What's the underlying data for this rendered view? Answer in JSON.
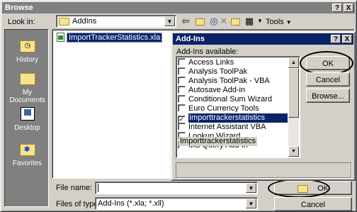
{
  "browse": {
    "title": "Browse",
    "title_buttons": [
      "?",
      "X"
    ],
    "look_in_label": "Look in:",
    "look_in_value": "AddIns",
    "tools_label": "Tools",
    "places": [
      "History",
      "My Documents",
      "Desktop",
      "Favorites"
    ],
    "file": "ImportTrackerStatistics.xla",
    "file_name_label": "File name:",
    "file_name_value": "",
    "files_of_type_label": "Files of type:",
    "files_of_type_value": "Add-Ins (*.xla; *.xll)",
    "ok_label": "OK",
    "cancel_label": "Cancel"
  },
  "addins": {
    "title": "Add-Ins",
    "title_buttons": [
      "?",
      "X"
    ],
    "available_label": "Add-Ins available:",
    "items": [
      {
        "label": "Access Links",
        "checked": false,
        "selected": false
      },
      {
        "label": "Analysis ToolPak",
        "checked": false,
        "selected": false
      },
      {
        "label": "Analysis ToolPak - VBA",
        "checked": false,
        "selected": false
      },
      {
        "label": "Autosave Add-in",
        "checked": false,
        "selected": false
      },
      {
        "label": "Conditional Sum Wizard",
        "checked": false,
        "selected": false
      },
      {
        "label": "Euro Currency Tools",
        "checked": false,
        "selected": false
      },
      {
        "label": "Importtrackerstatistics",
        "checked": true,
        "selected": true
      },
      {
        "label": "Internet Assistant VBA",
        "checked": false,
        "selected": false
      },
      {
        "label": "Lookup Wizard",
        "checked": false,
        "selected": false
      },
      {
        "label": "MS Query Add-in",
        "checked": false,
        "selected": false
      }
    ],
    "description_title": "Importtrackerstatistics",
    "ok_label": "OK",
    "cancel_label": "Cancel",
    "browse_label": "Browse..."
  }
}
